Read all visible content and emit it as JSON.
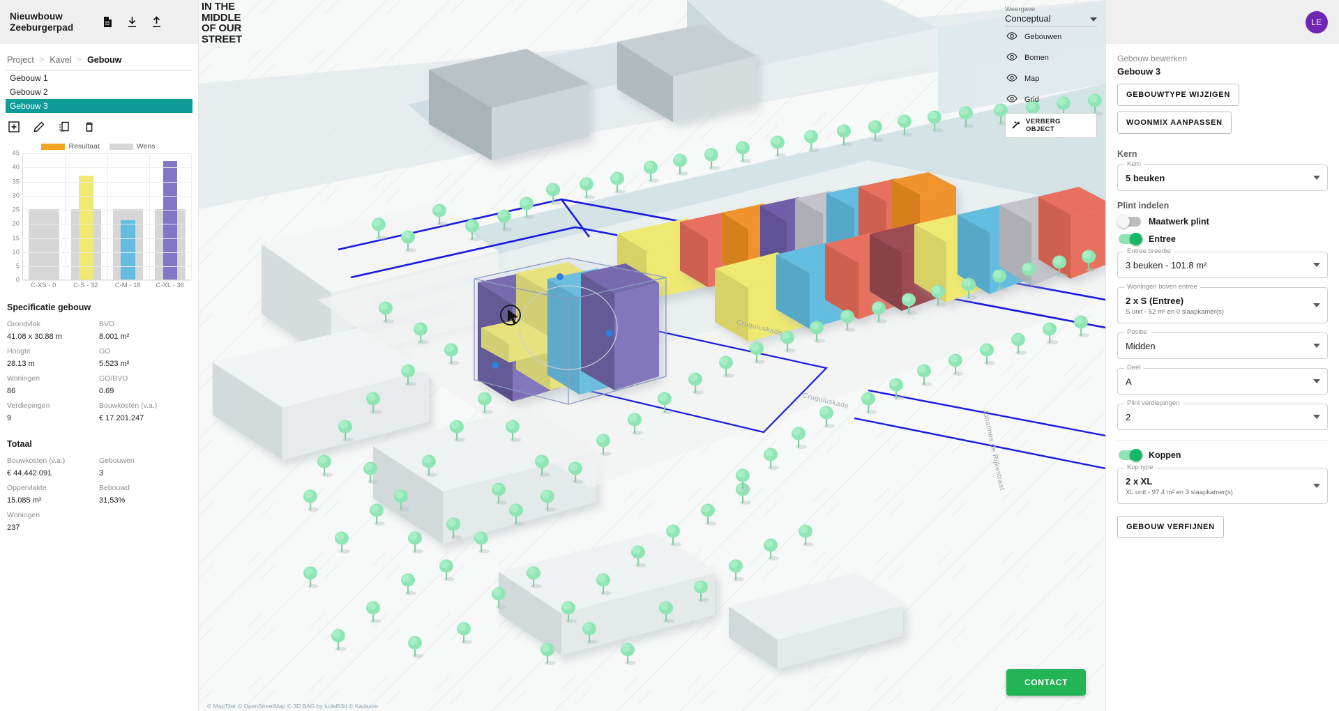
{
  "left": {
    "project_title": "Nieuwbouw\nZeeburgerpad",
    "header_icons": [
      "document-icon",
      "download-icon",
      "upload-icon"
    ],
    "breadcrumb": [
      "Project",
      "Kavel",
      "Gebouw"
    ],
    "breadcrumb_sep": ">",
    "buildings": [
      "Gebouw 1",
      "Gebouw 2",
      "Gebouw 3"
    ],
    "selected_building": "Gebouw 3",
    "tools": [
      "add-icon",
      "edit-icon",
      "duplicate-icon",
      "delete-icon"
    ],
    "spec": {
      "heading": "Specificatie gebouw",
      "rows": [
        {
          "k": "Grondvlak",
          "v": "41.08 x 30.88 m"
        },
        {
          "k": "BVO",
          "v": "8.001 m²"
        },
        {
          "k": "Hoogte",
          "v": "28.13 m"
        },
        {
          "k": "GO",
          "v": "5.523 m²"
        },
        {
          "k": "Woningen",
          "v": "86"
        },
        {
          "k": "GO/BVO",
          "v": "0.69"
        },
        {
          "k": "Verdiepingen",
          "v": "9"
        },
        {
          "k": "Bouwkosten (v.a.)",
          "v": "€ 17.201.247"
        }
      ]
    },
    "totaal": {
      "heading": "Totaal",
      "rows": [
        {
          "k": "Bouwkosten (v.a.)",
          "v": "€ 44.442.091"
        },
        {
          "k": "Gebouwen",
          "v": "3"
        },
        {
          "k": "Oppervlakte",
          "v": "15.085 m²"
        },
        {
          "k": "Bebouwd",
          "v": "31,53%"
        },
        {
          "k": "Woningen",
          "v": "237"
        },
        {
          "k": "",
          "v": ""
        }
      ]
    }
  },
  "chart_data": {
    "type": "bar",
    "title": "",
    "xlabel": "",
    "ylabel": "",
    "ylim": [
      0,
      45
    ],
    "yticks": [
      0,
      5,
      10,
      15,
      20,
      25,
      30,
      35,
      40,
      45
    ],
    "grid": true,
    "legend_position": "top-center",
    "categories": [
      "C-XS - 0",
      "C-S - 32",
      "C-M - 18",
      "C-XL - 36"
    ],
    "series": [
      {
        "name": "Wens",
        "color": "#d6d6d6",
        "values": [
          25,
          25,
          25,
          25
        ]
      },
      {
        "name": "Resultaat",
        "color": "#f2a51e",
        "values": [
          0,
          37,
          21,
          42
        ]
      }
    ],
    "bar_colors": [
      "#f2a51e",
      "#efe871",
      "#63bde0",
      "#8277c7"
    ],
    "legend": [
      "Resultaat",
      "Wens"
    ]
  },
  "viewport": {
    "logo": "IN THE\nMIDDLE\nOF OUR\nSTREET",
    "attribution": "© MapTiler © OpenStreetMap © 3D BAG by tudelft3d © Kadaster",
    "contact_label": "CONTACT",
    "street_labels": [
      "Cruquiuskade",
      "Cruquiuskade",
      "Johannes de Rijkestraat"
    ],
    "layers": {
      "weergave_label": "Weergave",
      "weergave_value": "Conceptual",
      "items": [
        "Gebouwen",
        "Bomen",
        "Map",
        "Grid"
      ],
      "hide_object_label": "VERBERG OBJECT"
    }
  },
  "right": {
    "avatar_initials": "LE",
    "subtitle": "Gebouw bewerken",
    "title": "Gebouw 3",
    "buttons": [
      "GEBOUWTYPE WIJZIGEN",
      "WOONMIX AANPASSEN"
    ],
    "kern_heading": "Kern",
    "kern_field": {
      "label": "Kern",
      "value": "5 beuken"
    },
    "plint_heading": "Plint indelen",
    "maatwerk": {
      "label": "Maatwerk plint",
      "on": false
    },
    "entree": {
      "label": "Entree",
      "on": true
    },
    "fields": [
      {
        "label": "Entree breedte",
        "value": "3 beuken - 101.8 m²",
        "sub": ""
      },
      {
        "label": "Woningen boven entree",
        "value": "2 x S (Entree)",
        "sub": "S unit - 52 m² en 0 slaapkamer(s)"
      },
      {
        "label": "Positie",
        "value": "Midden",
        "sub": ""
      },
      {
        "label": "Deel",
        "value": "A",
        "sub": ""
      },
      {
        "label": "Plint verdiepingen",
        "value": "2",
        "sub": ""
      }
    ],
    "koppen": {
      "label": "Koppen",
      "on": true
    },
    "kop_field": {
      "label": "Kop type",
      "value": "2 x XL",
      "sub": "XL unit - 97.4 m² en 3 slaapkamer(s)"
    },
    "verfijnen_label": "GEBOUW VERFIJNEN"
  },
  "colors": {
    "accent_teal": "#0f9c99",
    "green": "#22b455",
    "toggle_green": "#14b866",
    "avatar_purple": "#7026b5"
  }
}
